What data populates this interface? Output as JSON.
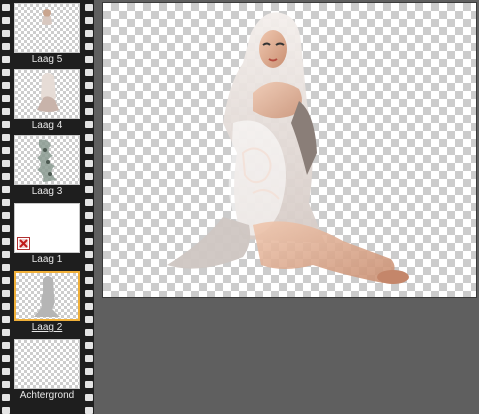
{
  "layers_panel": {
    "layers": [
      {
        "name": "Laag 5",
        "thumb": "small-figure",
        "selected": false
      },
      {
        "name": "Laag 4",
        "thumb": "figure",
        "selected": false
      },
      {
        "name": "Laag 3",
        "thumb": "lace-pattern",
        "selected": false
      },
      {
        "name": "Laag 1",
        "thumb": "white-mask",
        "selected": false,
        "badge_icon": "mask-disabled-icon"
      },
      {
        "name": "Laag 2",
        "thumb": "silhouette",
        "selected": true
      },
      {
        "name": "Achtergrond",
        "thumb": "transparent",
        "selected": false
      }
    ]
  },
  "canvas": {
    "content": "seated-woman-in-veil-photo"
  },
  "colors": {
    "panel_bg": "#1e1e1e",
    "workspace_bg": "#5f5f5f",
    "selection_border": "#f0b039",
    "label_color": "#e8e8e8"
  }
}
